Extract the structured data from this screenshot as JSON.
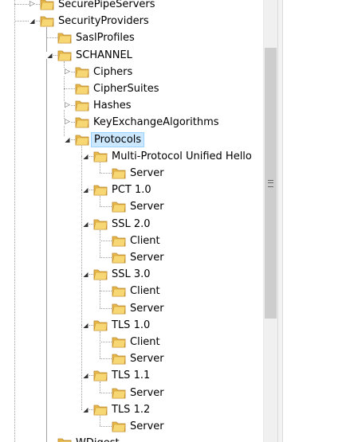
{
  "tree": {
    "nodes": [
      {
        "label": "SecurePipeServers",
        "depth": 0,
        "state": "collapsed"
      },
      {
        "label": "SecurityProviders",
        "depth": 0,
        "state": "expanded"
      },
      {
        "label": "SaslProfiles",
        "depth": 1,
        "state": "none"
      },
      {
        "label": "SCHANNEL",
        "depth": 1,
        "state": "expanded"
      },
      {
        "label": "Ciphers",
        "depth": 2,
        "state": "collapsed"
      },
      {
        "label": "CipherSuites",
        "depth": 2,
        "state": "none"
      },
      {
        "label": "Hashes",
        "depth": 2,
        "state": "collapsed"
      },
      {
        "label": "KeyExchangeAlgorithms",
        "depth": 2,
        "state": "collapsed"
      },
      {
        "label": "Protocols",
        "depth": 2,
        "state": "expanded",
        "selected": true
      },
      {
        "label": "Multi-Protocol Unified Hello",
        "depth": 3,
        "state": "expanded"
      },
      {
        "label": "Server",
        "depth": 4,
        "state": "none"
      },
      {
        "label": "PCT 1.0",
        "depth": 3,
        "state": "expanded"
      },
      {
        "label": "Server",
        "depth": 4,
        "state": "none"
      },
      {
        "label": "SSL 2.0",
        "depth": 3,
        "state": "expanded"
      },
      {
        "label": "Client",
        "depth": 4,
        "state": "none"
      },
      {
        "label": "Server",
        "depth": 4,
        "state": "none"
      },
      {
        "label": "SSL 3.0",
        "depth": 3,
        "state": "expanded"
      },
      {
        "label": "Client",
        "depth": 4,
        "state": "none"
      },
      {
        "label": "Server",
        "depth": 4,
        "state": "none"
      },
      {
        "label": "TLS 1.0",
        "depth": 3,
        "state": "expanded"
      },
      {
        "label": "Client",
        "depth": 4,
        "state": "none"
      },
      {
        "label": "Server",
        "depth": 4,
        "state": "none"
      },
      {
        "label": "TLS 1.1",
        "depth": 3,
        "state": "expanded"
      },
      {
        "label": "Server",
        "depth": 4,
        "state": "none"
      },
      {
        "label": "TLS 1.2",
        "depth": 3,
        "state": "expanded"
      },
      {
        "label": "Server",
        "depth": 4,
        "state": "none"
      },
      {
        "label": "WDigest",
        "depth": 1,
        "state": "none"
      }
    ]
  },
  "colors": {
    "selection_bg": "#cce8ff",
    "selection_border": "#99d1ff",
    "folder_body": "#e8b84a",
    "folder_front": "#f7d774"
  }
}
